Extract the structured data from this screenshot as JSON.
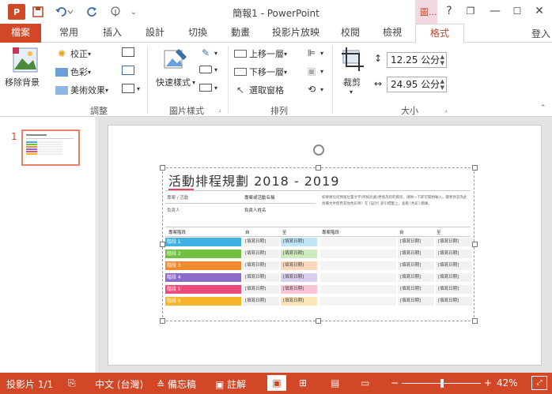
{
  "app": {
    "logo": "P",
    "title": "簡報1 - PowerPoint",
    "context_group": "圖..."
  },
  "qat": {
    "save": "save-icon",
    "undo": "undo-icon",
    "redo": "redo-icon",
    "touch": "touch-mode-icon"
  },
  "window": {
    "help": "?",
    "restore": "❐",
    "minimize": "—",
    "maximize": "☐",
    "close": "✕"
  },
  "tabs": [
    "檔案",
    "常用",
    "插入",
    "設計",
    "切換",
    "動畫",
    "投影片放映",
    "校閱",
    "檢視",
    "格式"
  ],
  "user": "登入",
  "ribbon": {
    "remove_bg": "移除背景",
    "adjust": {
      "correct": "校正",
      "color": "色彩",
      "artistic": "美術效果",
      "label": "調整"
    },
    "styles": {
      "quick": "快速樣式",
      "label": "圖片樣式"
    },
    "arrange": {
      "forward": "上移一層",
      "backward": "下移一層",
      "pane": "選取窗格",
      "label": "排列"
    },
    "size": {
      "crop": "裁剪",
      "height": "12.25 公分",
      "width": "24.95 公分",
      "label": "大小"
    }
  },
  "thumbs": {
    "number": "1"
  },
  "slide": {
    "title": "活動排程規劃 2018 - 2019",
    "info": {
      "project_label": "專案 / 活動",
      "project_value": "專案或活動名稱",
      "owner_label": "負責人",
      "owner_value": "負責人姓名",
      "note": "如要將任何預留位置文字(例如此處)更換為您的資訊，請將一下即可開始輸入。變更頁首為此頁欄文件使用其他色彩嗎？在 [設計] 索引標籤上，查看 [色彩] 圖庫。"
    },
    "headers": [
      "專案階段",
      "自",
      "至",
      "專案階段",
      "自",
      "至"
    ],
    "phases": [
      {
        "name": "階段 1",
        "color": "#3fb1e3"
      },
      {
        "name": "階段 2",
        "color": "#6fc13f"
      },
      {
        "name": "階段 3",
        "color": "#f28b30"
      },
      {
        "name": "階段 4",
        "color": "#8c6ccb"
      },
      {
        "name": "階段 5",
        "color": "#e94b7b"
      },
      {
        "name": "階段 6",
        "color": "#f7b52c"
      }
    ],
    "date_placeholder": "[填寫日期]"
  },
  "status": {
    "slide": "投影片 1/1",
    "language": "中文 (台灣)",
    "notes": "備忘稿",
    "comments": "註解",
    "zoom": "42%",
    "zoom_minus": "−",
    "zoom_plus": "+"
  }
}
